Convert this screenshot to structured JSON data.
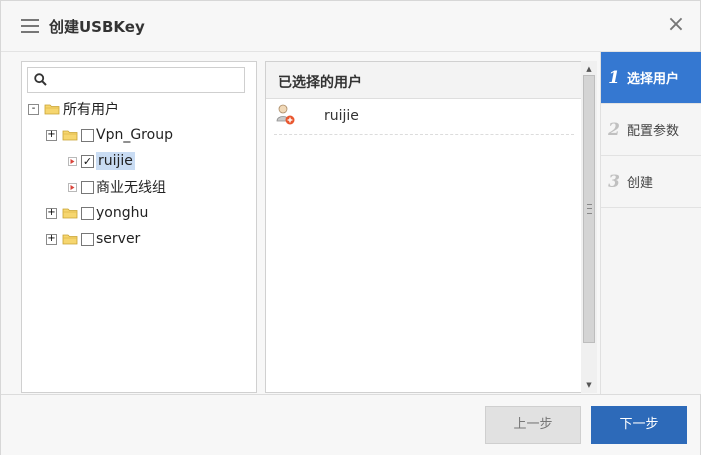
{
  "dialog": {
    "title": "创建USBKey",
    "close_glyph": "×"
  },
  "tree": {
    "search_placeholder": "",
    "root": {
      "label": "所有用户",
      "toggle": "-"
    },
    "nodes": [
      {
        "label": "Vpn_Group",
        "toggle": "+"
      },
      {
        "label": "ruijie",
        "checked": true
      },
      {
        "label": "商业无线组",
        "checked": false
      },
      {
        "label": "yonghu",
        "toggle": "+"
      },
      {
        "label": "server",
        "toggle": "+"
      }
    ]
  },
  "selected_users": {
    "header": "已选择的用户",
    "items": [
      {
        "name": "ruijie"
      }
    ]
  },
  "steps": [
    {
      "num": "1",
      "label": "选择用户",
      "active": true
    },
    {
      "num": "2",
      "label": "配置参数",
      "active": false
    },
    {
      "num": "3",
      "label": "创建",
      "active": false
    }
  ],
  "footer": {
    "prev_label": "上一步",
    "next_label": "下一步"
  },
  "colors": {
    "accent": "#3578d1",
    "primary_button": "#2d6ab9",
    "disabled_button": "#e1e1e1",
    "folder": "#f2c94c"
  },
  "icons": {
    "menu": "hamburger-menu-icon",
    "close": "close-icon",
    "search": "search-icon",
    "folder": "folder-icon",
    "user": "user-add-icon"
  }
}
